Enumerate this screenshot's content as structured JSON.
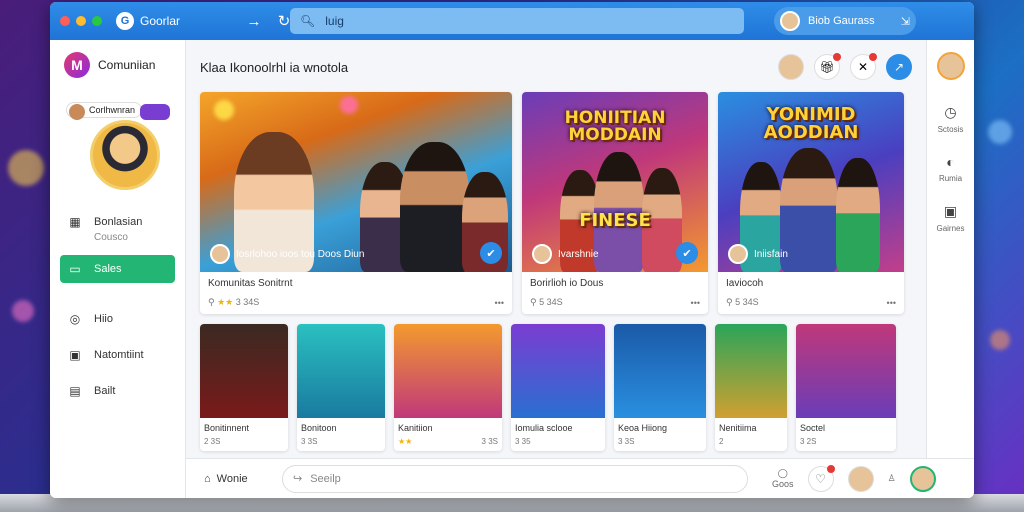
{
  "window": {
    "tab_title": "Goorlar",
    "search_placeholder": "luig",
    "account_label": "Biob Gaurass"
  },
  "colors": {
    "topbar": "#1f74d6",
    "active_nav": "#22b573",
    "accent": "#2b8de6"
  },
  "sidebar": {
    "brand": "Comuniian",
    "profile_tag": "Corlhwnran",
    "items": [
      {
        "label": "Bonlasian",
        "sub": "Cousco",
        "icon": "grid-icon"
      },
      {
        "label": "Sales",
        "icon": "tv-icon"
      },
      {
        "label": "Hiio",
        "icon": "globe-icon"
      },
      {
        "label": "Natomtiint",
        "icon": "image-icon"
      },
      {
        "label": "Bailt",
        "icon": "calendar-icon"
      }
    ]
  },
  "main": {
    "title": "Klaa Ikonoolrhl ia wnotola",
    "featured": [
      {
        "overlay": "Iosrlohoo ioos tou Doos Diun",
        "title": "Komunitas Sonitrnt",
        "rating": "3 34S",
        "poster": ""
      },
      {
        "overlay": "Ivarshnie",
        "title": "Borirlioh io Dous",
        "rating": "5 34S",
        "poster_lines": [
          "HONIITIAN",
          "MODDAIN"
        ],
        "banner": "FINESE"
      },
      {
        "overlay": "Iniisfain",
        "title": "Iaviocoh",
        "rating": "5 34S",
        "poster_lines": [
          "YONIMID",
          "AODDIAN"
        ]
      }
    ],
    "small": [
      {
        "title": "Bonitinnent",
        "rating": "2 3S"
      },
      {
        "title": "Bonitoon",
        "rating": "3 3S"
      },
      {
        "title": "Kanitiion",
        "rating": "3 3S"
      },
      {
        "title": "Iomulia sclooe",
        "rating": "3 35"
      },
      {
        "title": "Keoa Hiiong",
        "rating": "3 3S"
      },
      {
        "title": "Nenitiima",
        "rating": "2"
      },
      {
        "title": "Soctel",
        "rating": "3 2S"
      }
    ]
  },
  "rightbar": {
    "items": [
      {
        "label": "Sctosis",
        "icon": "timer-icon"
      },
      {
        "label": "Rumia",
        "icon": "compass-icon"
      },
      {
        "label": "Gairnes",
        "icon": "media-icon"
      }
    ]
  },
  "bottombar": {
    "home_label": "Wonie",
    "input_placeholder": "Seeilp",
    "right_label": "Goos"
  }
}
